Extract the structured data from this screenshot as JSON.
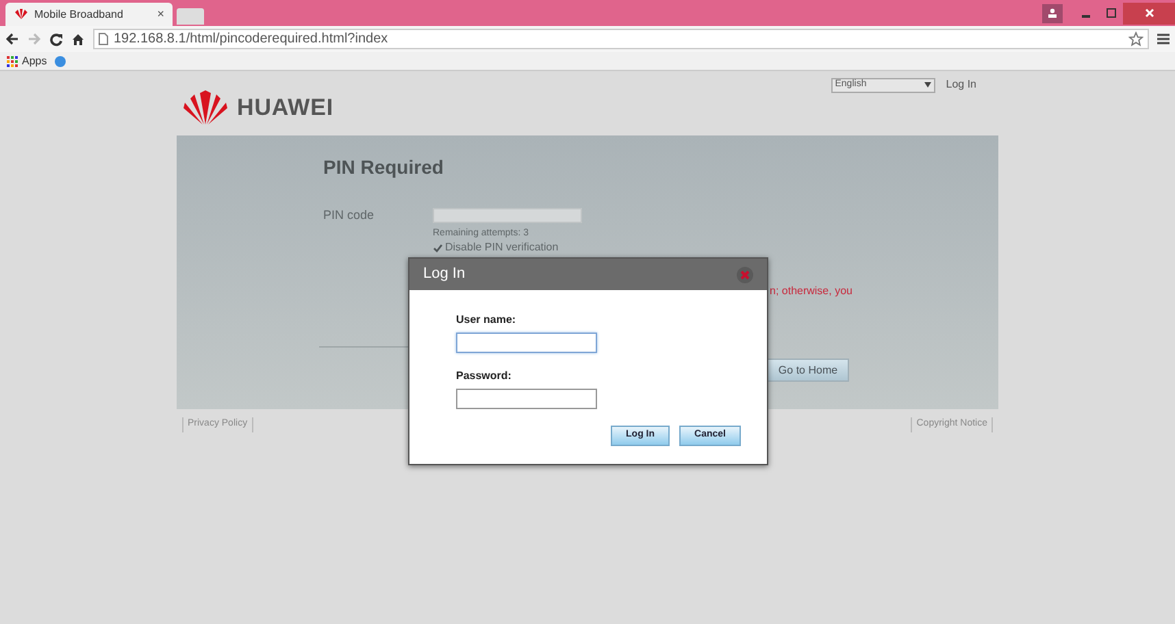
{
  "browser": {
    "tab": {
      "title": "Mobile Broadband",
      "close": "×"
    },
    "url": "192.168.8.1/html/pincoderequired.html?index",
    "bookmarks": [
      {
        "label": "Apps"
      }
    ]
  },
  "header": {
    "brand": "HUAWEI",
    "language": "English",
    "login_link": "Log In"
  },
  "pin_panel": {
    "title": "PIN Required",
    "pin_label": "PIN code",
    "remaining": "Remaining attempts: 3",
    "disable_pin": {
      "label": "Disable PIN verification",
      "checked": true
    },
    "warning_fragment": "n; otherwise, you",
    "go_home": "Go to Home"
  },
  "footer": {
    "privacy": "Privacy Policy",
    "copyright": "Copyright Notice"
  },
  "dialog": {
    "title": "Log In",
    "fields": [
      {
        "label": "User name:",
        "focused": true
      },
      {
        "label": "Password:",
        "focused": false
      }
    ],
    "buttons": [
      "Log In",
      "Cancel"
    ]
  }
}
